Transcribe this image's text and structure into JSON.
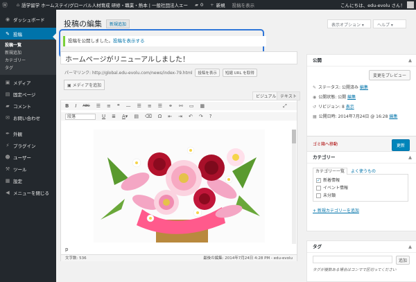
{
  "admin_bar": {
    "site_name": "語学留学 ホームステイ/グローバル人材育成 研修・職業・熱本 | 一般社団法人エー",
    "comments": "0",
    "new_label": "新規",
    "view_post": "投稿を表示",
    "greeting": "こんにちは、edu-evolu さん！"
  },
  "sidebar": {
    "items": [
      {
        "icon": "dashboard-icon",
        "glyph": "◉",
        "label": "ダッシュボード"
      },
      {
        "icon": "pin-icon",
        "glyph": "✎",
        "label": "投稿"
      },
      {
        "icon": "media-icon",
        "glyph": "▣",
        "label": "メディア"
      },
      {
        "icon": "page-icon",
        "glyph": "▤",
        "label": "固定ページ"
      },
      {
        "icon": "comment-icon",
        "glyph": "▰",
        "label": "コメント"
      },
      {
        "icon": "contact-icon",
        "glyph": "✉",
        "label": "お問い合わせ"
      },
      {
        "icon": "appearance-icon",
        "glyph": "✒",
        "label": "外観"
      },
      {
        "icon": "plugin-icon",
        "glyph": "⚡",
        "label": "プラグイン"
      },
      {
        "icon": "users-icon",
        "glyph": "☻",
        "label": "ユーザー"
      },
      {
        "icon": "tools-icon",
        "glyph": "⚒",
        "label": "ツール"
      },
      {
        "icon": "settings-icon",
        "glyph": "▦",
        "label": "設定"
      },
      {
        "icon": "collapse-icon",
        "glyph": "◀",
        "label": "メニューを閉じる"
      }
    ],
    "posts_submenu": [
      "投稿一覧",
      "新規追加",
      "カテゴリー",
      "タグ"
    ]
  },
  "header": {
    "title": "投稿の編集",
    "add_new": "新規追加",
    "screen_options": "表示オプション ▾",
    "help": "ヘルプ ▾"
  },
  "notice": {
    "text": "投稿を公開しました。",
    "link": "投稿を表示する"
  },
  "post": {
    "title": "ホームページがリニューアルしました！",
    "permalink_label": "パーマリンク:",
    "permalink_url": "http://global.edu-evolu.com/news/index-79.html",
    "view_btn": "投稿を表示",
    "shortlink_btn": "短縮 URL を取得"
  },
  "editor": {
    "media_btn": "メディアを追加",
    "tab_visual": "ビジュアル",
    "tab_text": "テキスト",
    "format": "段落",
    "paragraph_mark": "p",
    "word_count": "文字数: 536",
    "last_edit": "最後の編集: 2014年7月24日 4:28 PM - edu-evolu"
  },
  "publish": {
    "title": "公開",
    "preview": "変更をプレビュー",
    "status_label": "ステータス: 公開済み",
    "visibility_label": "公開状態: 公開",
    "revisions_label": "リビジョン: 8",
    "revisions_link": "表示",
    "date_label": "公開日時: 2014年7月24日 @ 16:28",
    "edit": "編集",
    "trash": "ゴミ箱へ移動",
    "update": "更新"
  },
  "categories": {
    "title": "カテゴリー",
    "tab_all": "カテゴリー一覧",
    "tab_popular": "よく使うもの",
    "items": [
      {
        "label": "新着情報",
        "checked": true
      },
      {
        "label": "イベント情報",
        "checked": false
      },
      {
        "label": "未分類",
        "checked": false
      }
    ],
    "add_link": "+ 新規カテゴリーを追加"
  },
  "tags": {
    "title": "タグ",
    "add_btn": "追加",
    "hint": "タグが複数ある場合はコンマで区切ってください"
  },
  "colors": {
    "admin_bg": "#23282d",
    "accent": "#0073aa",
    "update": "#0085ba",
    "notice_border": "#7ad03a",
    "highlight": "#2e75d8"
  }
}
